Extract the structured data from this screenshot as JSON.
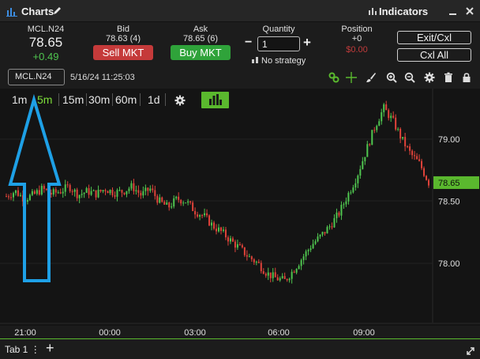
{
  "titlebar": {
    "title": "Charts",
    "indicators_label": "Indicators",
    "colors": {
      "background": "#262626",
      "accent": "#5ab82e"
    }
  },
  "instrument": {
    "symbol": "MCL.N24",
    "last_price": "78.65",
    "change": "+0.49",
    "change_color": "#4fc54f"
  },
  "bid": {
    "label": "Bid",
    "value": "78.63 (4)",
    "button": "Sell MKT",
    "button_color": "#c53a3a"
  },
  "ask": {
    "label": "Ask",
    "value": "78.65 (6)",
    "button": "Buy MKT",
    "button_color": "#2fa33a"
  },
  "quantity": {
    "label": "Quantity",
    "value": "1",
    "minus": "−",
    "plus": "+"
  },
  "strategy": {
    "label": "No strategy"
  },
  "position": {
    "label": "Position",
    "value": "+0",
    "pnl": "$0.00",
    "pnl_color": "#c03b3b"
  },
  "actions": {
    "exit_cxl": "Exit/Cxl",
    "cxl_all": "Cxl All"
  },
  "toolbar": {
    "symbol_field": "MCL.N24",
    "datetime": "5/16/24 11:25:03",
    "icons": [
      "link-icon",
      "crosshair-icon",
      "brush-icon",
      "zoom-in-icon",
      "zoom-out-icon",
      "gear-icon",
      "trash-icon",
      "lock-icon"
    ]
  },
  "timeframes": {
    "items": [
      "1m",
      "5m",
      "15m",
      "30m",
      "60m",
      "1d"
    ],
    "active": "5m"
  },
  "chart_data": {
    "type": "candlestick",
    "price_axis": {
      "ticks": [
        "79.00",
        "78.50",
        "78.00"
      ],
      "last_price_label": "78.65",
      "last_price_color": "#5ab82e"
    },
    "time_axis": {
      "ticks": [
        "21:00",
        "00:00",
        "03:00",
        "06:00",
        "09:00"
      ]
    },
    "colors": {
      "up": "#4fc54f",
      "down": "#e0433a",
      "background": "#141414"
    },
    "close_path": [
      78.54,
      78.58,
      78.52,
      78.55,
      78.6,
      78.56,
      78.58,
      78.62,
      78.55,
      78.58,
      78.56,
      78.6,
      78.57,
      78.58,
      78.62,
      78.55,
      78.6,
      78.5,
      78.45,
      78.52,
      78.5,
      78.42,
      78.38,
      78.3,
      78.25,
      78.18,
      78.12,
      78.05,
      78.0,
      77.92,
      77.88,
      77.86,
      77.95,
      78.05,
      78.15,
      78.22,
      78.3,
      78.4,
      78.55,
      78.7,
      78.9,
      79.1,
      79.25,
      79.15,
      79.0,
      78.88,
      78.8,
      78.65
    ]
  },
  "annotation": {
    "type": "arrow",
    "color": "#1ea0e6"
  },
  "statusbar": {
    "tab_label": "Tab 1 ⋮",
    "add_tab": "+"
  }
}
